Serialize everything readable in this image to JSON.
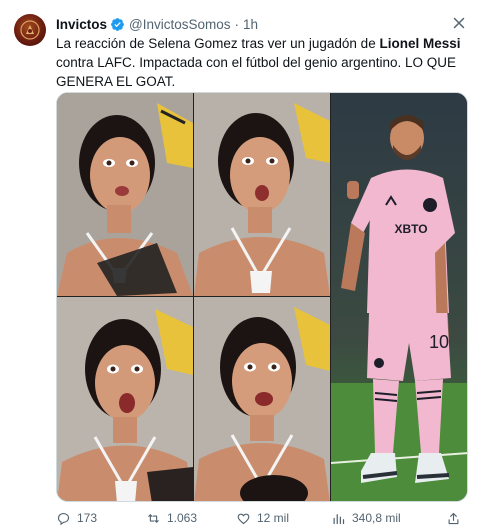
{
  "tweet": {
    "author_name": "Invictos",
    "author_handle": "@InvictosSomos",
    "separator": "·",
    "time": "1h",
    "text_part1": "La reacción de Selena Gomez tras ver un jugadón de ",
    "text_bold": "Lionel Messi",
    "text_part2": " contra LAFC. Impactada con el fútbol del genio argentino. LO QUE GENERA EL GOAT."
  },
  "media": {
    "panels": [
      "reaction-1",
      "reaction-2",
      "reaction-3",
      "reaction-4",
      "player-photo"
    ],
    "jersey_number": "10",
    "jersey_sponsor": "XBTO"
  },
  "actions": {
    "replies": "173",
    "retweets": "1.063",
    "likes": "12 mil",
    "views": "340,8 mil"
  },
  "colors": {
    "verified": "#1d9bf0",
    "muted": "#536471",
    "text": "#0f1419",
    "jersey_pink": "#f2b8cf"
  }
}
